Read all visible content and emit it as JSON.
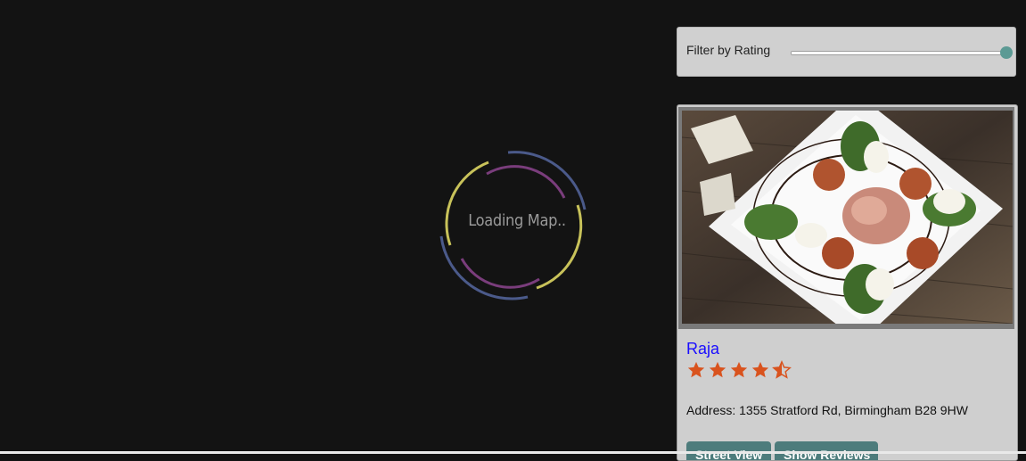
{
  "map": {
    "loading_text": "Loading Map.."
  },
  "filter": {
    "label": "Filter by Rating",
    "slider_value_fraction": 1.0
  },
  "restaurant": {
    "name": "Raja",
    "rating": 4.5,
    "rating_max": 5,
    "address": "Address: 1355 Stratford Rd, Birmingham B28 9HW",
    "photo_icon": "food-photo",
    "buttons": {
      "street_view": "Street View",
      "show_reviews": "Show Reviews"
    }
  },
  "colors": {
    "background": "#131313",
    "panel": "#d0d0d0",
    "accent": "#5c9a94",
    "star": "#d9531e",
    "link": "#1a0dff",
    "button": "#4d7c7c",
    "loader_yellow": "#c8c25a",
    "loader_blue": "#4b5a8a",
    "loader_purple": "#7a3d7c"
  }
}
